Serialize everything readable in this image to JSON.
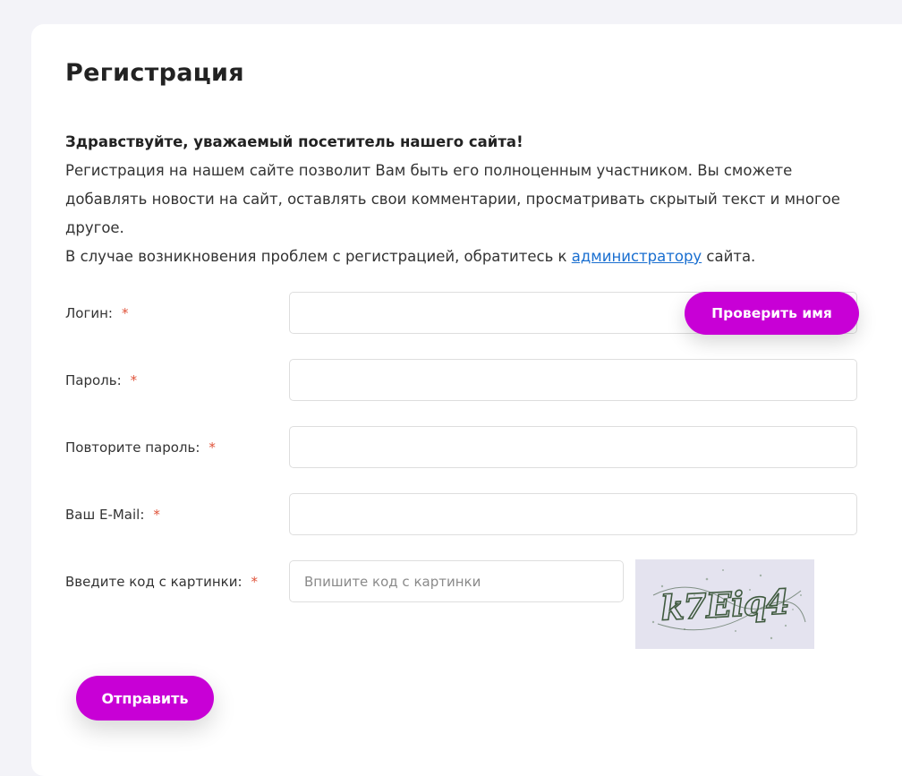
{
  "page": {
    "title": "Регистрация",
    "intro": {
      "greeting": "Здравствуйте, уважаемый посетитель нашего сайта!",
      "line1": "Регистрация на нашем сайте позволит Вам быть его полноценным участником. Вы сможете добавлять новости на сайт, оставлять свои комментарии, просматривать скрытый текст и многое другое.",
      "line2_before": "В случае возникновения проблем с регистрацией, обратитесь к ",
      "link": "администратору",
      "line2_after": " сайта."
    }
  },
  "form": {
    "required_mark": "*",
    "login": {
      "label": "Логин:",
      "value": ""
    },
    "check_name_button": "Проверить имя",
    "password": {
      "label": "Пароль:",
      "value": ""
    },
    "password_repeat": {
      "label": "Повторите пароль:",
      "value": ""
    },
    "email": {
      "label": "Ваш E-Mail:",
      "value": ""
    },
    "captcha": {
      "label": "Введите код с картинки:",
      "placeholder": "Впишите код с картинки",
      "value": "",
      "image_text": "k7Eiq4"
    },
    "submit_button": "Отправить"
  },
  "colors": {
    "accent": "#c800d6",
    "required": "#e0533a",
    "link": "#1a6fd0",
    "captcha_bg": "#e4e3ef",
    "captcha_ink": "#3f5a3f"
  }
}
